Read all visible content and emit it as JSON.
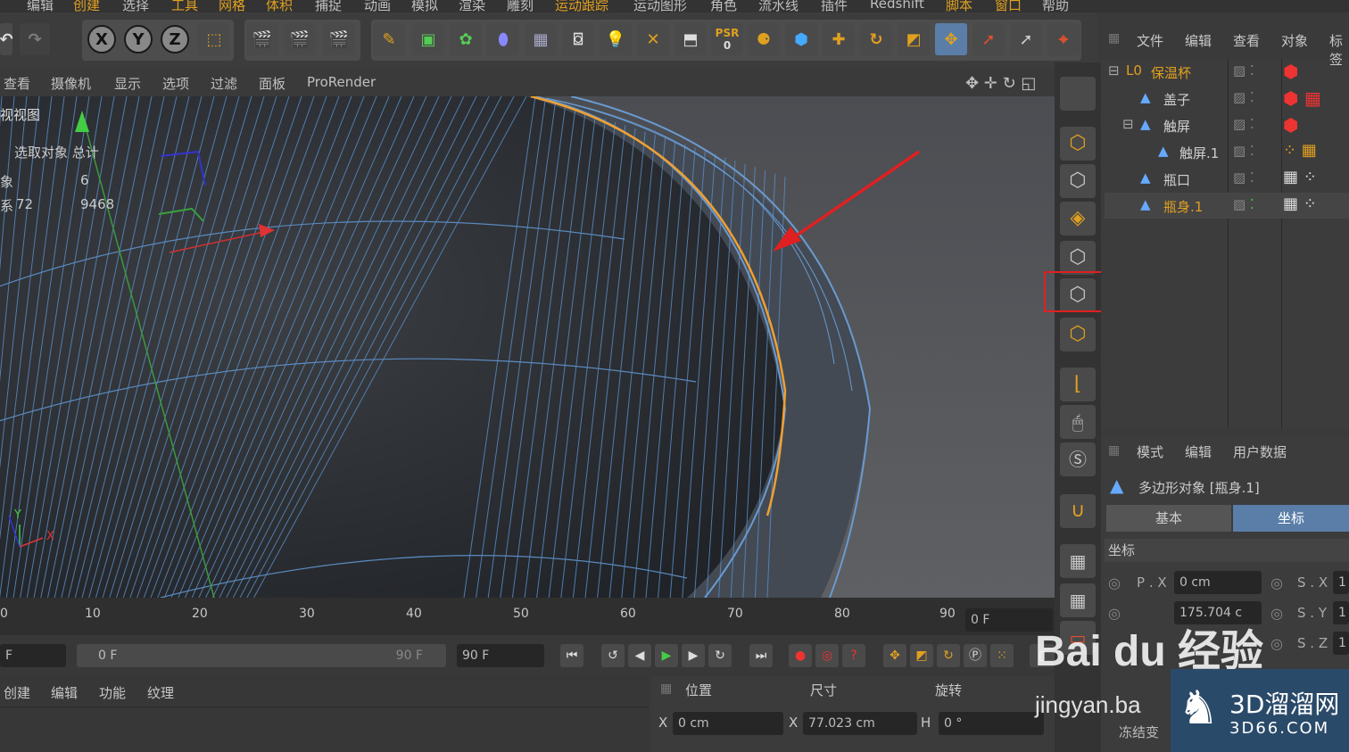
{
  "menubar": {
    "items": [
      "编辑",
      "创建",
      "选择",
      "工具",
      "网格",
      "体积",
      "捕捉",
      "动画",
      "模拟",
      "渲染",
      "雕刻",
      "运动跟踪",
      "运动图形",
      "角色",
      "流水线",
      "插件",
      "Redshift",
      "脚本",
      "窗口",
      "帮助"
    ]
  },
  "toolbar": {
    "axis_x": "X",
    "axis_y": "Y",
    "axis_z": "Z",
    "psr_label": "PSR",
    "psr_value": "0"
  },
  "viewport": {
    "menu": [
      "查看",
      "摄像机",
      "显示",
      "选项",
      "过滤",
      "面板",
      "ProRender"
    ],
    "title": "视视图",
    "stats_header": "选取对象 总计",
    "stats_row1": [
      "象",
      "6"
    ],
    "stats_row2": [
      "系",
      "72",
      "9468"
    ],
    "axis_y": "Y",
    "axis_x": "X"
  },
  "timeline": {
    "ticks": [
      "0",
      "10",
      "20",
      "30",
      "40",
      "50",
      "60",
      "70",
      "80",
      "90"
    ],
    "current_frame": "0 F"
  },
  "playbar": {
    "start_field": "F",
    "range_start": "0 F",
    "range_end": "90 F",
    "end_field": "90 F"
  },
  "material_menu": [
    "创建",
    "编辑",
    "功能",
    "纹理"
  ],
  "coords": {
    "headers": [
      "位置",
      "尺寸",
      "旋转"
    ],
    "pos_x_label": "X",
    "pos_x": "0 cm",
    "size_x_label": "X",
    "size_x": "77.023 cm",
    "rot_h_label": "H",
    "rot_h": "0 °"
  },
  "object_manager": {
    "menu": [
      "文件",
      "编辑",
      "查看",
      "对象",
      "标签"
    ],
    "objects": [
      {
        "name": "保温杯",
        "color": "#e0a020"
      },
      {
        "name": "盖子",
        "color": "#d0d0d0"
      },
      {
        "name": "触屏",
        "color": "#d0d0d0"
      },
      {
        "name": "触屏.1",
        "color": "#d0d0d0"
      },
      {
        "name": "瓶口",
        "color": "#d0d0d0"
      },
      {
        "name": "瓶身.1",
        "color": "#e0a020"
      }
    ]
  },
  "attributes": {
    "menu": [
      "模式",
      "编辑",
      "用户数据"
    ],
    "object_title": "多边形对象 [瓶身.1]",
    "tabs": [
      "基本",
      "坐标"
    ],
    "section": "坐标",
    "px_label": "P . X",
    "px": "0 cm",
    "py_value": "175.704 c",
    "sx_label": "S . X",
    "sy_label": "S . Y",
    "sz_label": "S . Z",
    "scale_partial": "1",
    "freeze_label": "冻结变"
  },
  "watermark": {
    "baidu": "Bai du 经验",
    "jingyan": "jingyan.ba",
    "site_cn": "3D溜溜网",
    "site_url": "3D66.COM"
  },
  "colors": {
    "accent": "#e0a020",
    "highlight_box": "#e02020",
    "active_blue": "#5a7ea8"
  }
}
